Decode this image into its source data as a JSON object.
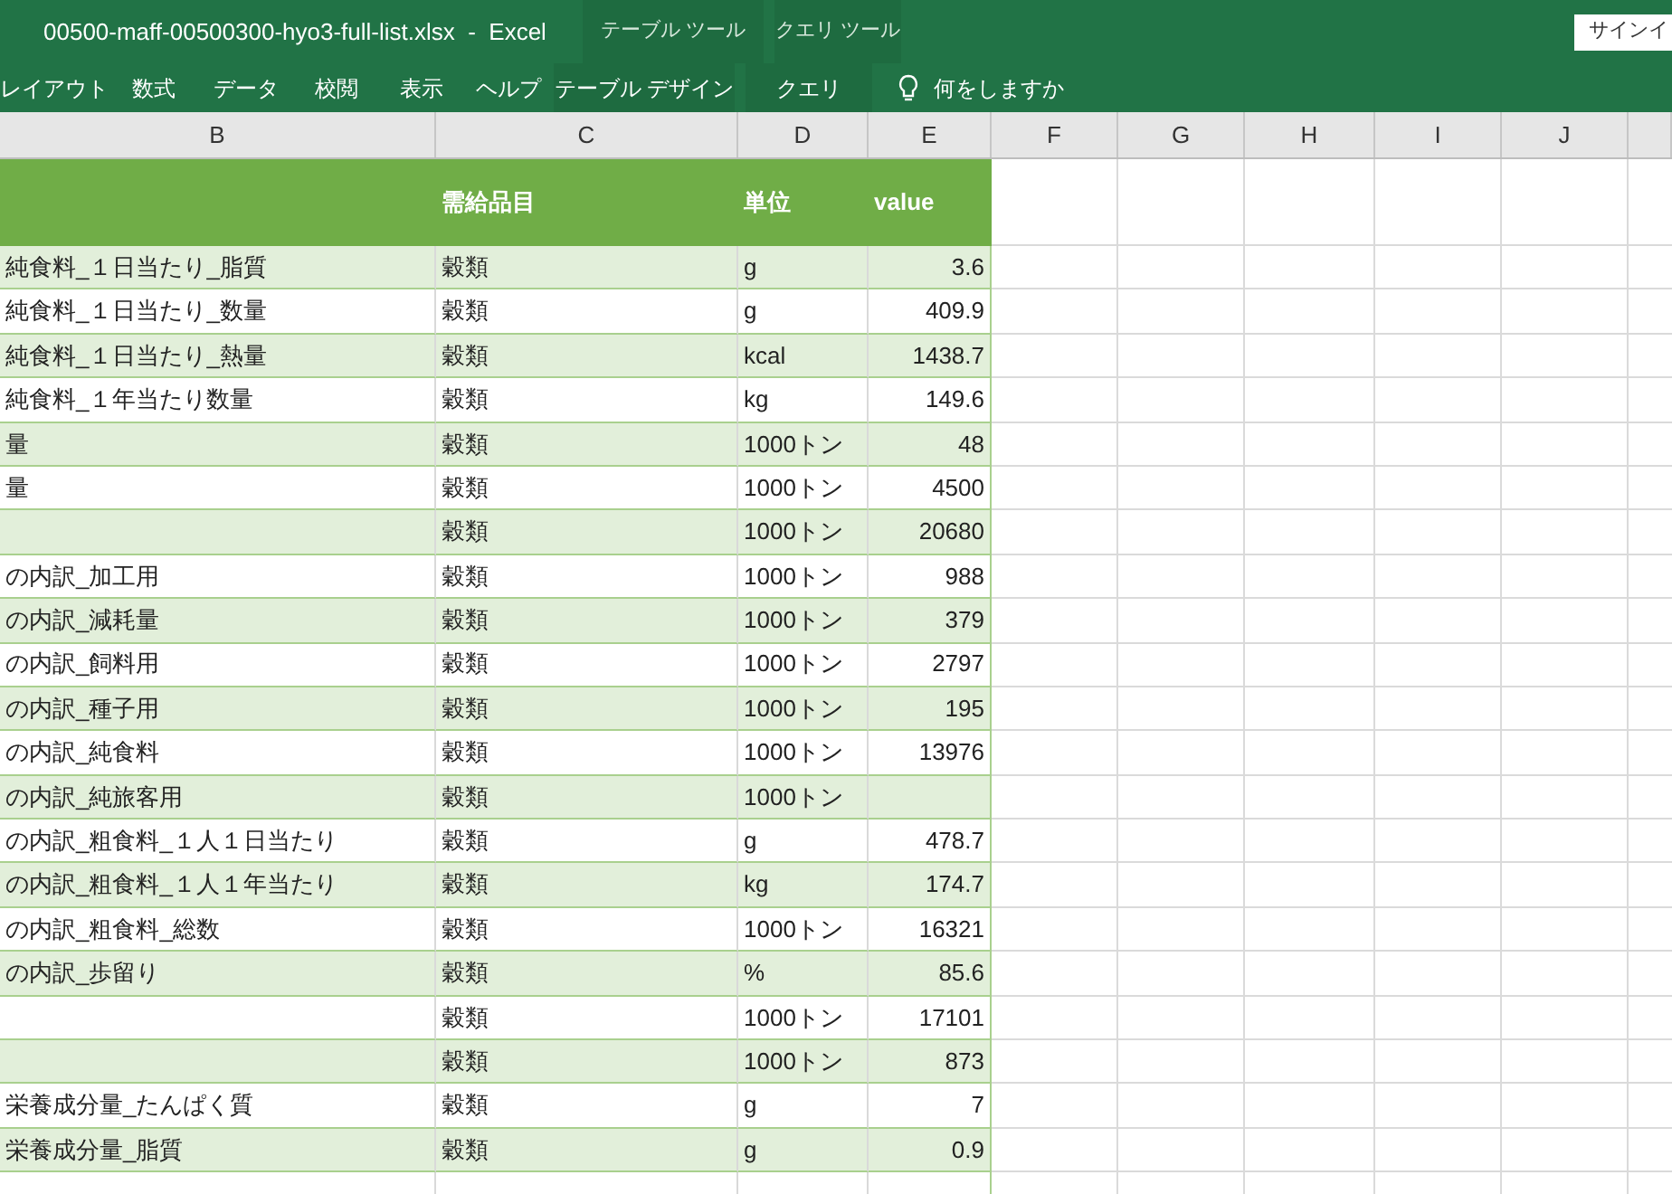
{
  "window": {
    "title": "00500-maff-00500300-hyo3-full-list.xlsx  -  Excel",
    "sign_in": "サインイ"
  },
  "context_groups": [
    {
      "label": "テーブル ツール"
    },
    {
      "label": "クエリ ツール"
    }
  ],
  "ribbon_tabs": [
    {
      "label": "レイアウト",
      "kind": "normal"
    },
    {
      "label": "数式",
      "kind": "normal"
    },
    {
      "label": "データ",
      "kind": "normal"
    },
    {
      "label": "校閲",
      "kind": "normal"
    },
    {
      "label": "表示",
      "kind": "normal"
    },
    {
      "label": "ヘルプ",
      "kind": "normal"
    },
    {
      "label": "テーブル デザイン",
      "kind": "contextual"
    },
    {
      "label": "クエリ",
      "kind": "contextual"
    }
  ],
  "tell_me": {
    "placeholder": "何をしますか"
  },
  "column_letters": [
    "B",
    "C",
    "D",
    "E",
    "F",
    "G",
    "H",
    "I",
    "J"
  ],
  "table": {
    "columns": [
      "需給品目",
      "単位",
      "value"
    ],
    "rows": [
      {
        "b": "純食料_１日当たり_脂質",
        "c": "穀類",
        "d": "g",
        "e": "3.6"
      },
      {
        "b": "純食料_１日当たり_数量",
        "c": "穀類",
        "d": "g",
        "e": "409.9"
      },
      {
        "b": "純食料_１日当たり_熱量",
        "c": "穀類",
        "d": "kcal",
        "e": "1438.7"
      },
      {
        "b": "純食料_１年当たり数量",
        "c": "穀類",
        "d": "kg",
        "e": "149.6"
      },
      {
        "b": "量",
        "c": "穀類",
        "d": "1000トン",
        "e": "48"
      },
      {
        "b": "量",
        "c": "穀類",
        "d": "1000トン",
        "e": "4500"
      },
      {
        "c": "穀類",
        "d": "1000トン",
        "e": "20680"
      },
      {
        "b": "の内訳_加工用",
        "c": "穀類",
        "d": "1000トン",
        "e": "988"
      },
      {
        "b": "の内訳_減耗量",
        "c": "穀類",
        "d": "1000トン",
        "e": "379"
      },
      {
        "b": "の内訳_飼料用",
        "c": "穀類",
        "d": "1000トン",
        "e": "2797"
      },
      {
        "b": "の内訳_種子用",
        "c": "穀類",
        "d": "1000トン",
        "e": "195"
      },
      {
        "b": "の内訳_純食料",
        "c": "穀類",
        "d": "1000トン",
        "e": "13976"
      },
      {
        "b": "の内訳_純旅客用",
        "c": "穀類",
        "d": "1000トン"
      },
      {
        "b": "の内訳_粗食料_１人１日当たり",
        "c": "穀類",
        "d": "g",
        "e": "478.7"
      },
      {
        "b": "の内訳_粗食料_１人１年当たり",
        "c": "穀類",
        "d": "kg",
        "e": "174.7"
      },
      {
        "b": "の内訳_粗食料_総数",
        "c": "穀類",
        "d": "1000トン",
        "e": "16321"
      },
      {
        "b": "の内訳_歩留り",
        "c": "穀類",
        "d": "%",
        "e": "85.6"
      },
      {
        "c": "穀類",
        "d": "1000トン",
        "e": "17101"
      },
      {
        "c": "穀類",
        "d": "1000トン",
        "e": "873"
      },
      {
        "b": "栄養成分量_たんぱく質",
        "c": "穀類",
        "d": "g",
        "e": "7"
      },
      {
        "b": "栄養成分量_脂質",
        "c": "穀類",
        "d": "g",
        "e": "0.9"
      }
    ]
  }
}
